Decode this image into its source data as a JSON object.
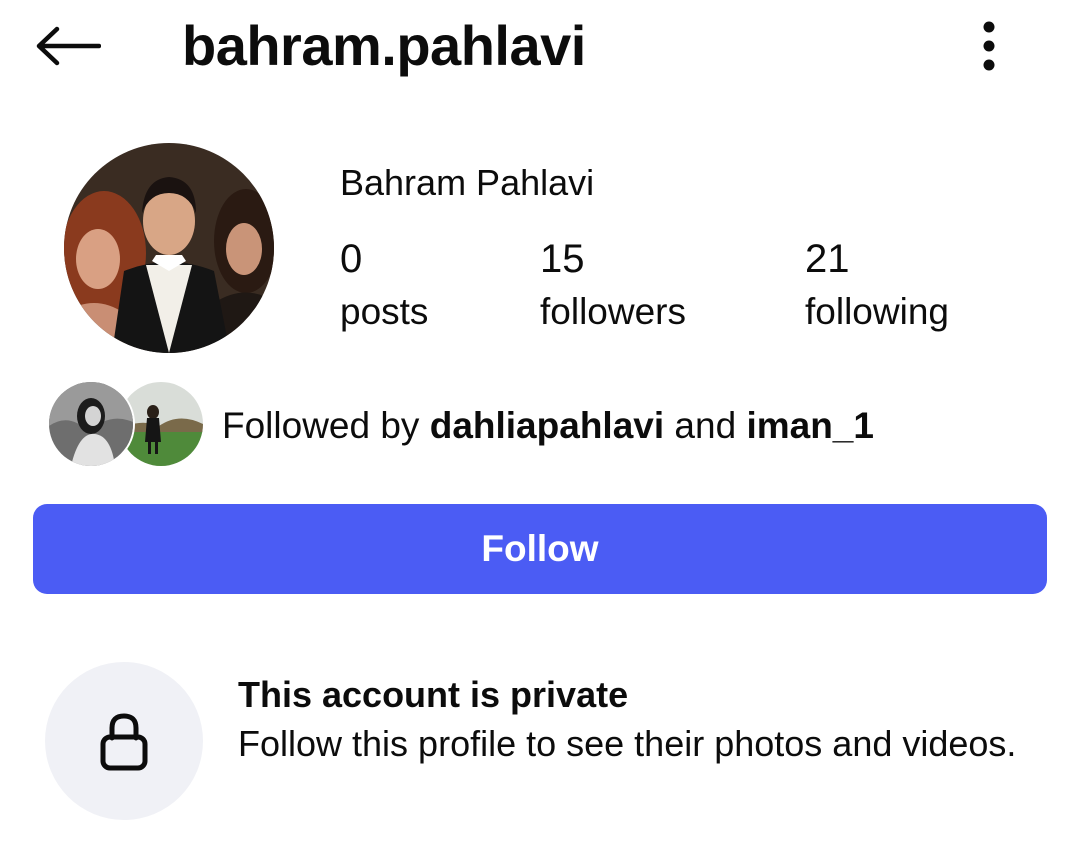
{
  "header": {
    "back_icon": "arrow-left-icon",
    "username": "bahram.pahlavi",
    "menu_icon": "more-vertical-icon"
  },
  "profile": {
    "full_name": "Bahram Pahlavi",
    "stats": [
      {
        "value": "0",
        "label": "posts"
      },
      {
        "value": "15",
        "label": "followers"
      },
      {
        "value": "21",
        "label": "following"
      }
    ]
  },
  "mutuals": {
    "prefix": "Followed by",
    "user1": "dahliapahlavi",
    "joiner": "and",
    "user2": "iman_1"
  },
  "follow_button": {
    "label": "Follow",
    "color": "#4b5cf4"
  },
  "private_notice": {
    "icon": "lock-icon",
    "title": "This account is private",
    "body": "Follow this profile to see their photos and videos."
  }
}
